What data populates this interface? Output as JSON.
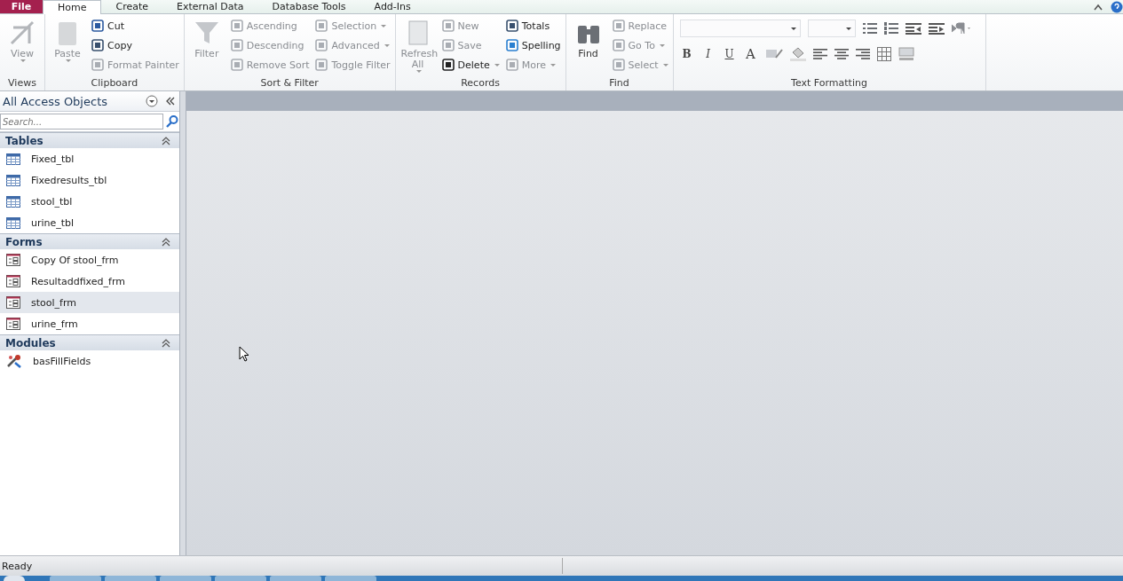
{
  "tabs": [
    {
      "label": "File",
      "kind": "file",
      "selected": false
    },
    {
      "label": "Home",
      "kind": "tab",
      "selected": true
    },
    {
      "label": "Create",
      "kind": "tab",
      "selected": false
    },
    {
      "label": "External Data",
      "kind": "tab",
      "selected": false
    },
    {
      "label": "Database Tools",
      "kind": "tab",
      "selected": false
    },
    {
      "label": "Add-Ins",
      "kind": "tab",
      "selected": false
    }
  ],
  "ribbon": {
    "groups": [
      {
        "label": "Views",
        "large": [
          {
            "label": "View",
            "disabled": true,
            "dropdown": true
          }
        ]
      },
      {
        "label": "Clipboard",
        "large": [
          {
            "label": "Paste",
            "disabled": true,
            "dropdown": true
          }
        ],
        "columns": [
          [
            {
              "label": "Cut",
              "disabled": false,
              "dropdown": false
            },
            {
              "label": "Copy",
              "disabled": false,
              "dropdown": false
            },
            {
              "label": "Format Painter",
              "disabled": true,
              "dropdown": false
            }
          ]
        ]
      },
      {
        "label": "Sort & Filter",
        "large": [
          {
            "label": "Filter",
            "disabled": true,
            "dropdown": false
          }
        ],
        "columns": [
          [
            {
              "label": "Ascending",
              "disabled": true,
              "dropdown": false
            },
            {
              "label": "Descending",
              "disabled": true,
              "dropdown": false
            },
            {
              "label": "Remove Sort",
              "disabled": true,
              "dropdown": false
            }
          ],
          [
            {
              "label": "Selection",
              "disabled": true,
              "dropdown": true
            },
            {
              "label": "Advanced",
              "disabled": true,
              "dropdown": true
            },
            {
              "label": "Toggle Filter",
              "disabled": true,
              "dropdown": false
            }
          ]
        ]
      },
      {
        "label": "Records",
        "large": [
          {
            "label": "Refresh All",
            "disabled": true,
            "dropdown": true
          }
        ],
        "columns": [
          [
            {
              "label": "New",
              "disabled": true,
              "dropdown": false
            },
            {
              "label": "Save",
              "disabled": true,
              "dropdown": false
            },
            {
              "label": "Delete",
              "disabled": false,
              "dropdown": true
            }
          ],
          [
            {
              "label": "Totals",
              "disabled": false,
              "dropdown": false
            },
            {
              "label": "Spelling",
              "disabled": false,
              "dropdown": false
            },
            {
              "label": "More",
              "disabled": true,
              "dropdown": true
            }
          ]
        ]
      },
      {
        "label": "Find",
        "large": [
          {
            "label": "Find",
            "disabled": false,
            "dropdown": false
          }
        ],
        "columns": [
          [
            {
              "label": "Replace",
              "disabled": true,
              "dropdown": false
            },
            {
              "label": "Go To",
              "disabled": true,
              "dropdown": true
            },
            {
              "label": "Select",
              "disabled": true,
              "dropdown": true
            }
          ]
        ]
      }
    ],
    "text_formatting": {
      "label": "Text Formatting",
      "style_buttons": [
        "B",
        "I",
        "U"
      ],
      "font_color_button": "A"
    }
  },
  "nav_pane": {
    "title": "All Access Objects",
    "search": {
      "placeholder": "Search..."
    },
    "groups": [
      {
        "label": "Tables",
        "kind": "table",
        "items": [
          {
            "label": "Fixed_tbl",
            "selected": false
          },
          {
            "label": "Fixedresults_tbl",
            "selected": false
          },
          {
            "label": "stool_tbl",
            "selected": false
          },
          {
            "label": "urine_tbl",
            "selected": false
          }
        ]
      },
      {
        "label": "Forms",
        "kind": "form",
        "items": [
          {
            "label": "Copy Of stool_frm",
            "selected": false
          },
          {
            "label": "Resultaddfixed_frm",
            "selected": false
          },
          {
            "label": "stool_frm",
            "selected": true
          },
          {
            "label": "urine_frm",
            "selected": false
          }
        ]
      },
      {
        "label": "Modules",
        "kind": "module",
        "items": [
          {
            "label": "basFillFields",
            "selected": false
          }
        ]
      }
    ]
  },
  "status_bar": {
    "text": "Ready"
  }
}
